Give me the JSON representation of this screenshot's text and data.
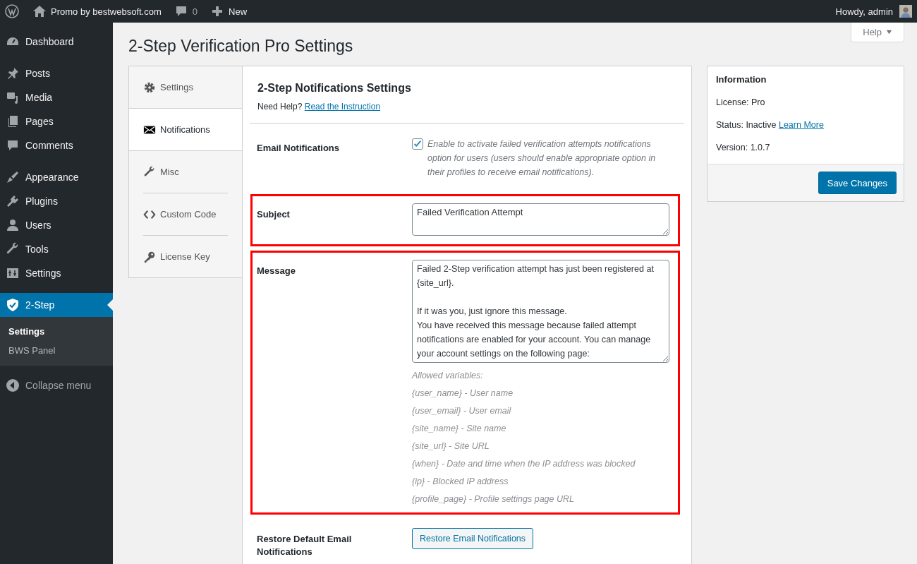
{
  "admin_bar": {
    "site_name": "Promo by bestwebsoft.com",
    "comments_count": "0",
    "new_label": "New",
    "greeting": "Howdy, admin"
  },
  "sidebar": {
    "groups": [
      [
        {
          "label": "Dashboard",
          "selected": false
        }
      ],
      [
        {
          "label": "Posts",
          "selected": false
        },
        {
          "label": "Media",
          "selected": false
        },
        {
          "label": "Pages",
          "selected": false
        },
        {
          "label": "Comments",
          "selected": false
        }
      ],
      [
        {
          "label": "Appearance",
          "selected": false
        },
        {
          "label": "Plugins",
          "selected": false
        },
        {
          "label": "Users",
          "selected": false
        },
        {
          "label": "Tools",
          "selected": false
        },
        {
          "label": "Settings",
          "selected": false
        }
      ],
      [
        {
          "label": "2-Step",
          "selected": true
        }
      ]
    ],
    "submenu": [
      {
        "label": "Settings",
        "selected": true
      },
      {
        "label": "BWS Panel",
        "selected": false
      }
    ],
    "collapse_label": "Collapse menu"
  },
  "help_button": "Help",
  "page_title": "2-Step Verification Pro Settings",
  "tabs": [
    {
      "label": "Settings",
      "selected": false
    },
    {
      "label": "Notifications",
      "selected": true
    },
    {
      "label": "Misc",
      "selected": false
    },
    {
      "label": "Custom Code",
      "selected": false
    },
    {
      "label": "License Key",
      "selected": false
    }
  ],
  "section": {
    "title": "2-Step Notifications Settings",
    "help_prefix": "Need Help?",
    "help_link": "Read the Instruction"
  },
  "fields": [
    {
      "kind": "checkbox",
      "label": "Email Notifications",
      "checked": true,
      "highlighted": false,
      "description": "Enable to activate failed verification attempts notifications option for users (users should enable appropriate option in their profiles to receive email notifications)."
    },
    {
      "kind": "text",
      "label": "Subject",
      "highlighted": true,
      "value": "Failed Verification Attempt"
    },
    {
      "kind": "textarea",
      "label": "Message",
      "highlighted": true,
      "value": "Failed 2-Step verification attempt has just been registered at {site_url}.\n\nIf it was you, just ignore this message.\nYou have received this message because failed attempt notifications are enabled for your account. You can manage your account settings on the following page:",
      "hint_title": "Allowed variables:",
      "variables": [
        "{user_name} - User name",
        "{user_email} - User email",
        "{site_name} - Site name",
        "{site_url} - Site URL",
        "{when} - Date and time when the IP address was blocked",
        "{ip} - Blocked IP address",
        "{profile_page} - Profile settings page URL"
      ]
    },
    {
      "kind": "button",
      "label": "Restore Default Email Notifications",
      "highlighted": false,
      "button_label": "Restore Email Notifications"
    }
  ],
  "info": {
    "title": "Information",
    "rows": [
      {
        "label": "License:",
        "value": "Pro"
      },
      {
        "label": "Status:",
        "value": "Inactive",
        "link": "Learn More"
      },
      {
        "label": "Version:",
        "value": "1.0.7"
      }
    ],
    "save_button": "Save Changes"
  }
}
